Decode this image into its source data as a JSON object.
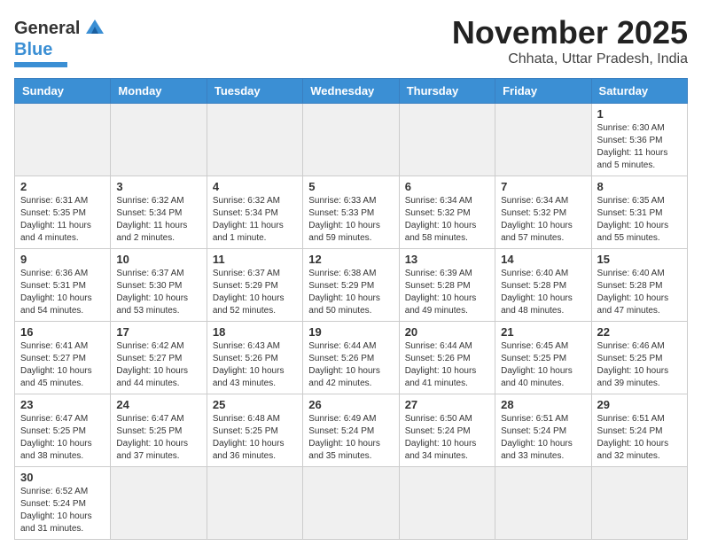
{
  "header": {
    "logo_general": "General",
    "logo_blue": "Blue",
    "month_title": "November 2025",
    "location": "Chhata, Uttar Pradesh, India"
  },
  "weekdays": [
    "Sunday",
    "Monday",
    "Tuesday",
    "Wednesday",
    "Thursday",
    "Friday",
    "Saturday"
  ],
  "days": [
    {
      "num": "",
      "info": ""
    },
    {
      "num": "",
      "info": ""
    },
    {
      "num": "",
      "info": ""
    },
    {
      "num": "",
      "info": ""
    },
    {
      "num": "",
      "info": ""
    },
    {
      "num": "",
      "info": ""
    },
    {
      "num": "1",
      "info": "Sunrise: 6:30 AM\nSunset: 5:36 PM\nDaylight: 11 hours\nand 5 minutes."
    },
    {
      "num": "2",
      "info": "Sunrise: 6:31 AM\nSunset: 5:35 PM\nDaylight: 11 hours\nand 4 minutes."
    },
    {
      "num": "3",
      "info": "Sunrise: 6:32 AM\nSunset: 5:34 PM\nDaylight: 11 hours\nand 2 minutes."
    },
    {
      "num": "4",
      "info": "Sunrise: 6:32 AM\nSunset: 5:34 PM\nDaylight: 11 hours\nand 1 minute."
    },
    {
      "num": "5",
      "info": "Sunrise: 6:33 AM\nSunset: 5:33 PM\nDaylight: 10 hours\nand 59 minutes."
    },
    {
      "num": "6",
      "info": "Sunrise: 6:34 AM\nSunset: 5:32 PM\nDaylight: 10 hours\nand 58 minutes."
    },
    {
      "num": "7",
      "info": "Sunrise: 6:34 AM\nSunset: 5:32 PM\nDaylight: 10 hours\nand 57 minutes."
    },
    {
      "num": "8",
      "info": "Sunrise: 6:35 AM\nSunset: 5:31 PM\nDaylight: 10 hours\nand 55 minutes."
    },
    {
      "num": "9",
      "info": "Sunrise: 6:36 AM\nSunset: 5:31 PM\nDaylight: 10 hours\nand 54 minutes."
    },
    {
      "num": "10",
      "info": "Sunrise: 6:37 AM\nSunset: 5:30 PM\nDaylight: 10 hours\nand 53 minutes."
    },
    {
      "num": "11",
      "info": "Sunrise: 6:37 AM\nSunset: 5:29 PM\nDaylight: 10 hours\nand 52 minutes."
    },
    {
      "num": "12",
      "info": "Sunrise: 6:38 AM\nSunset: 5:29 PM\nDaylight: 10 hours\nand 50 minutes."
    },
    {
      "num": "13",
      "info": "Sunrise: 6:39 AM\nSunset: 5:28 PM\nDaylight: 10 hours\nand 49 minutes."
    },
    {
      "num": "14",
      "info": "Sunrise: 6:40 AM\nSunset: 5:28 PM\nDaylight: 10 hours\nand 48 minutes."
    },
    {
      "num": "15",
      "info": "Sunrise: 6:40 AM\nSunset: 5:28 PM\nDaylight: 10 hours\nand 47 minutes."
    },
    {
      "num": "16",
      "info": "Sunrise: 6:41 AM\nSunset: 5:27 PM\nDaylight: 10 hours\nand 45 minutes."
    },
    {
      "num": "17",
      "info": "Sunrise: 6:42 AM\nSunset: 5:27 PM\nDaylight: 10 hours\nand 44 minutes."
    },
    {
      "num": "18",
      "info": "Sunrise: 6:43 AM\nSunset: 5:26 PM\nDaylight: 10 hours\nand 43 minutes."
    },
    {
      "num": "19",
      "info": "Sunrise: 6:44 AM\nSunset: 5:26 PM\nDaylight: 10 hours\nand 42 minutes."
    },
    {
      "num": "20",
      "info": "Sunrise: 6:44 AM\nSunset: 5:26 PM\nDaylight: 10 hours\nand 41 minutes."
    },
    {
      "num": "21",
      "info": "Sunrise: 6:45 AM\nSunset: 5:25 PM\nDaylight: 10 hours\nand 40 minutes."
    },
    {
      "num": "22",
      "info": "Sunrise: 6:46 AM\nSunset: 5:25 PM\nDaylight: 10 hours\nand 39 minutes."
    },
    {
      "num": "23",
      "info": "Sunrise: 6:47 AM\nSunset: 5:25 PM\nDaylight: 10 hours\nand 38 minutes."
    },
    {
      "num": "24",
      "info": "Sunrise: 6:47 AM\nSunset: 5:25 PM\nDaylight: 10 hours\nand 37 minutes."
    },
    {
      "num": "25",
      "info": "Sunrise: 6:48 AM\nSunset: 5:25 PM\nDaylight: 10 hours\nand 36 minutes."
    },
    {
      "num": "26",
      "info": "Sunrise: 6:49 AM\nSunset: 5:24 PM\nDaylight: 10 hours\nand 35 minutes."
    },
    {
      "num": "27",
      "info": "Sunrise: 6:50 AM\nSunset: 5:24 PM\nDaylight: 10 hours\nand 34 minutes."
    },
    {
      "num": "28",
      "info": "Sunrise: 6:51 AM\nSunset: 5:24 PM\nDaylight: 10 hours\nand 33 minutes."
    },
    {
      "num": "29",
      "info": "Sunrise: 6:51 AM\nSunset: 5:24 PM\nDaylight: 10 hours\nand 32 minutes."
    },
    {
      "num": "30",
      "info": "Sunrise: 6:52 AM\nSunset: 5:24 PM\nDaylight: 10 hours\nand 31 minutes."
    },
    {
      "num": "",
      "info": ""
    },
    {
      "num": "",
      "info": ""
    },
    {
      "num": "",
      "info": ""
    },
    {
      "num": "",
      "info": ""
    },
    {
      "num": "",
      "info": ""
    },
    {
      "num": "",
      "info": ""
    }
  ]
}
